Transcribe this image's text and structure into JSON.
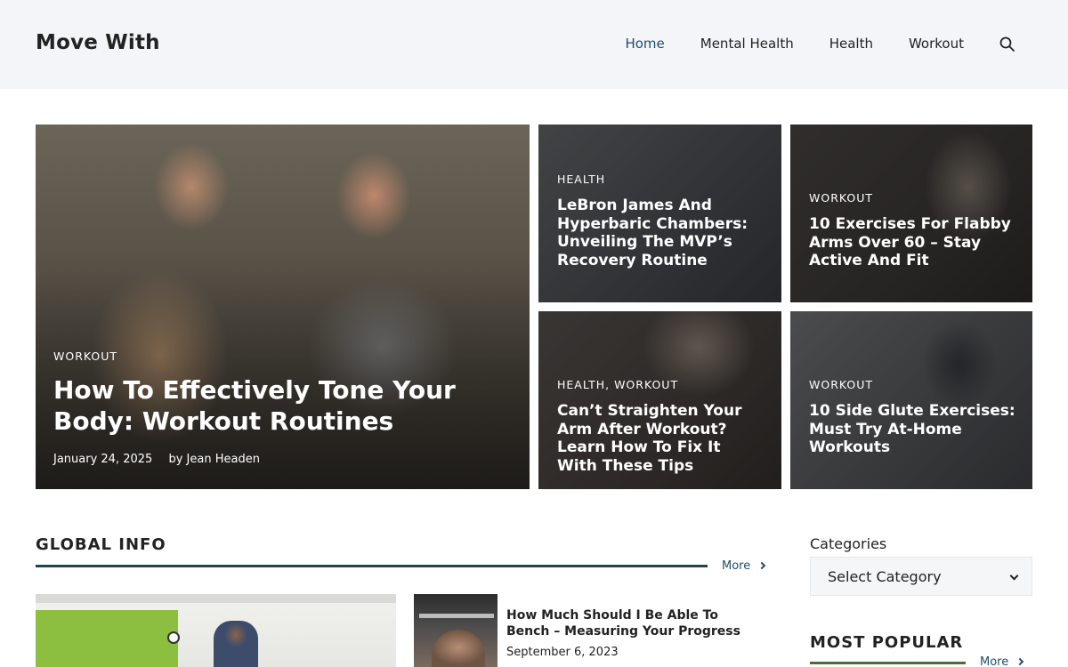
{
  "header": {
    "site_title": "Move With",
    "nav": [
      {
        "label": "Home",
        "active": true
      },
      {
        "label": "Mental Health",
        "active": false
      },
      {
        "label": "Health",
        "active": false
      },
      {
        "label": "Workout",
        "active": false
      }
    ],
    "search_icon": "search-icon"
  },
  "hero": {
    "main": {
      "category": "WORKOUT",
      "title": "How To Effectively Tone Your Body: Workout Routines",
      "date": "January 24, 2025",
      "author": "by Jean Headen"
    },
    "tiles": [
      {
        "category": "HEALTH",
        "title": "LeBron James And Hyperbaric Chambers: Unveiling The MVP’s Recovery Routine"
      },
      {
        "category": "WORKOUT",
        "title": "10 Exercises For Flabby Arms Over 60 – Stay Active And Fit"
      },
      {
        "category": "HEALTH, WORKOUT",
        "title": "Can’t Straighten Your Arm After Workout? Learn How To Fix It With These Tips"
      },
      {
        "category": "WORKOUT",
        "title": "10 Side Glute Exercises: Must Try At-Home Workouts"
      }
    ]
  },
  "global_info": {
    "heading": "GLOBAL INFO",
    "more_label": "More",
    "posts": [
      {
        "title": "How Much Should I Be Able To Bench – Measuring Your Progress",
        "date": "September 6, 2023"
      }
    ]
  },
  "sidebar": {
    "categories_label": "Categories",
    "categories_select_value": "Select Category",
    "popular_heading": "MOST POPULAR",
    "popular_more_label": "More"
  },
  "colors": {
    "accent": "#1f4e6b",
    "header_bg": "#f3f5f8",
    "section_line": "#1f4350",
    "popular_line": "#4e6a3a"
  }
}
